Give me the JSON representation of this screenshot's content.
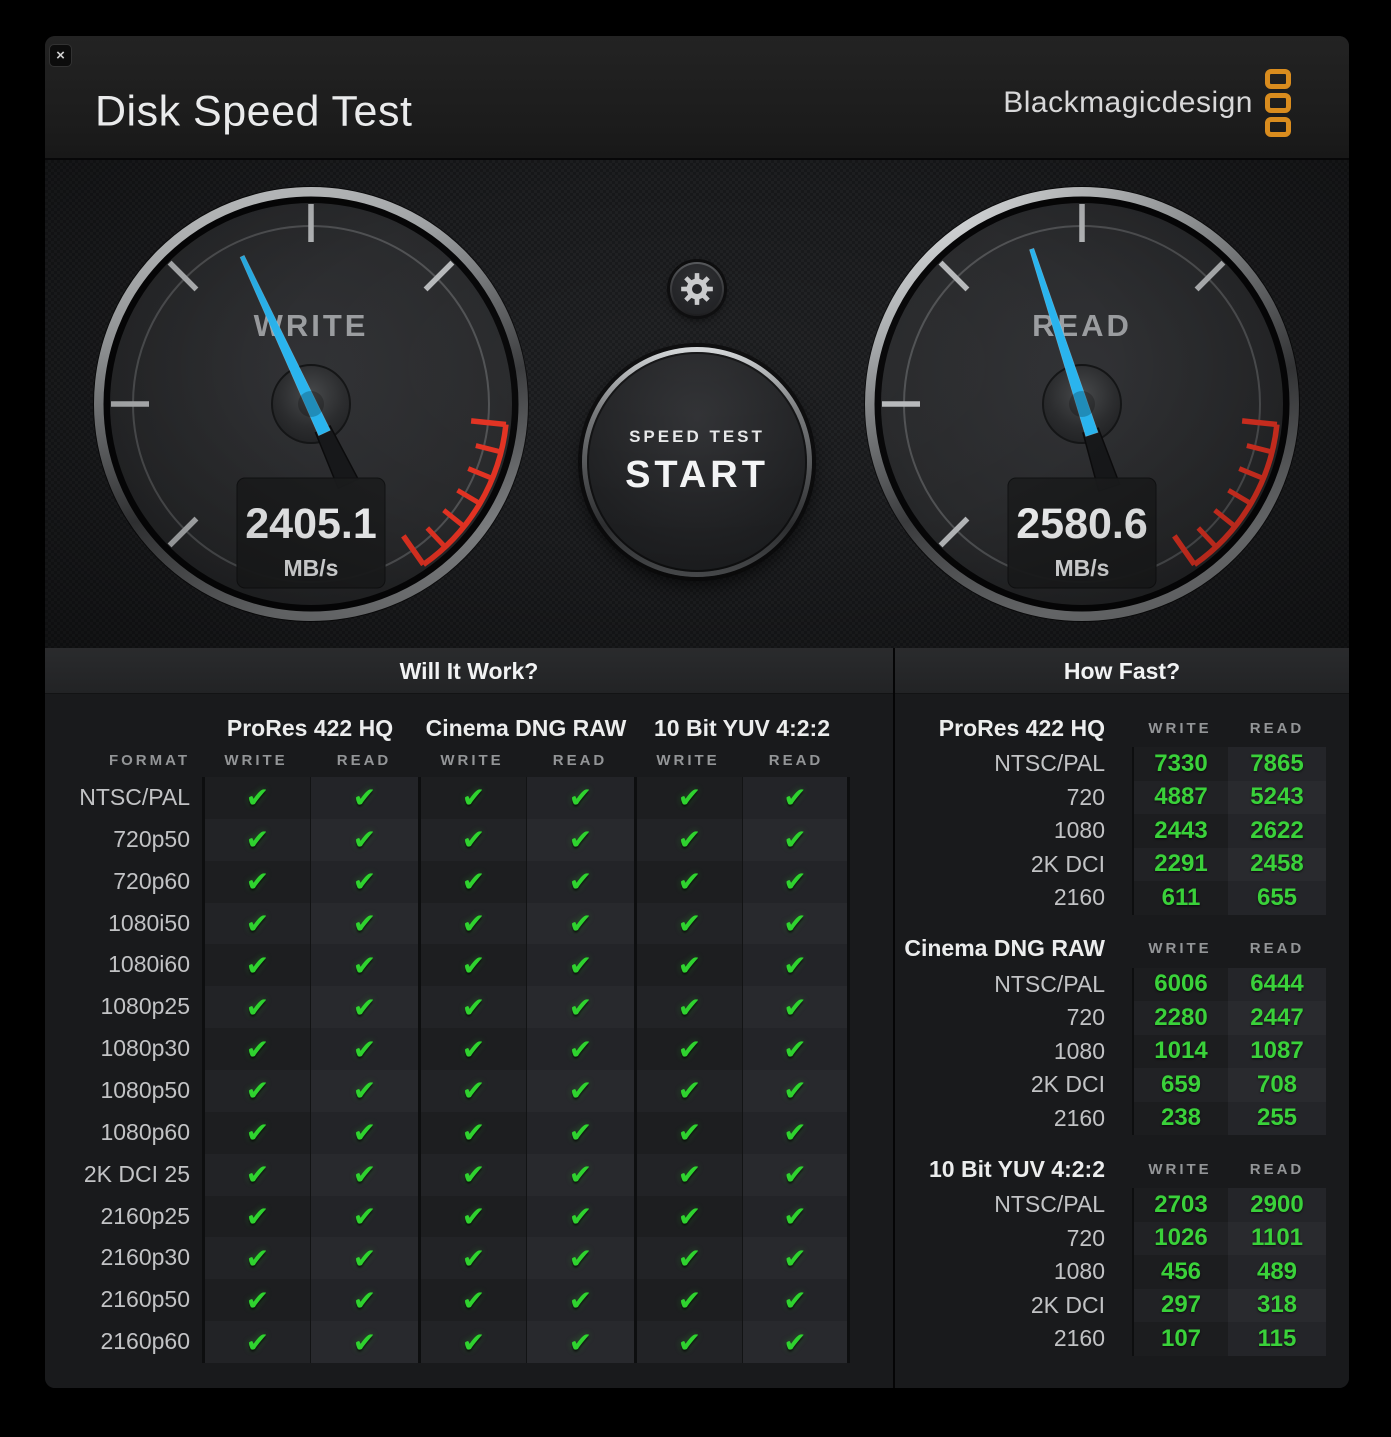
{
  "window": {
    "title": "Disk Speed Test",
    "brand": "Blackmagicdesign",
    "close_label": "×"
  },
  "controls": {
    "settings_icon": "gear-icon",
    "start_button": {
      "line1": "SPEED TEST",
      "line2": "START"
    }
  },
  "gauges": {
    "write": {
      "label": "WRITE",
      "value": "2405.1",
      "unit": "MB/s",
      "needle_angle_deg": -25
    },
    "read": {
      "label": "READ",
      "value": "2580.6",
      "unit": "MB/s",
      "needle_angle_deg": -18
    }
  },
  "will_it_work": {
    "title": "Will It Work?",
    "format_header": "FORMAT",
    "groups": [
      "ProRes 422 HQ",
      "Cinema DNG RAW",
      "10 Bit YUV 4:2:2"
    ],
    "sub_headers": [
      "WRITE",
      "READ"
    ],
    "check_glyph": "✔",
    "formats": [
      "NTSC/PAL",
      "720p50",
      "720p60",
      "1080i50",
      "1080i60",
      "1080p25",
      "1080p30",
      "1080p50",
      "1080p60",
      "2K DCI 25",
      "2160p25",
      "2160p30",
      "2160p50",
      "2160p60"
    ],
    "results": "all-pass"
  },
  "how_fast": {
    "title": "How Fast?",
    "sections": [
      {
        "name": "ProRes 422 HQ",
        "write_header": "WRITE",
        "read_header": "READ",
        "rows": [
          {
            "label": "NTSC/PAL",
            "write": "7330",
            "read": "7865"
          },
          {
            "label": "720",
            "write": "4887",
            "read": "5243"
          },
          {
            "label": "1080",
            "write": "2443",
            "read": "2622"
          },
          {
            "label": "2K DCI",
            "write": "2291",
            "read": "2458"
          },
          {
            "label": "2160",
            "write": "611",
            "read": "655"
          }
        ]
      },
      {
        "name": "Cinema DNG RAW",
        "write_header": "WRITE",
        "read_header": "READ",
        "rows": [
          {
            "label": "NTSC/PAL",
            "write": "6006",
            "read": "6444"
          },
          {
            "label": "720",
            "write": "2280",
            "read": "2447"
          },
          {
            "label": "1080",
            "write": "1014",
            "read": "1087"
          },
          {
            "label": "2K DCI",
            "write": "659",
            "read": "708"
          },
          {
            "label": "2160",
            "write": "238",
            "read": "255"
          }
        ]
      },
      {
        "name": "10 Bit YUV 4:2:2",
        "write_header": "WRITE",
        "read_header": "READ",
        "rows": [
          {
            "label": "NTSC/PAL",
            "write": "2703",
            "read": "2900"
          },
          {
            "label": "720",
            "write": "1026",
            "read": "1101"
          },
          {
            "label": "1080",
            "write": "456",
            "read": "489"
          },
          {
            "label": "2K DCI",
            "write": "297",
            "read": "318"
          },
          {
            "label": "2160",
            "write": "107",
            "read": "115"
          }
        ]
      }
    ]
  },
  "colors": {
    "needle_blue": "#2ab4ee",
    "check_green": "#2fd32f",
    "value_green": "#3ad13a",
    "logo_orange": "#d98c1e",
    "redline": "#e23222"
  }
}
